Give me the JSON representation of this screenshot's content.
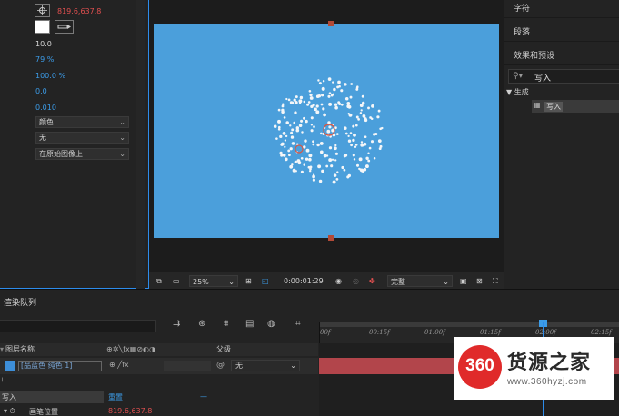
{
  "colors": {
    "accent_blue": "#2d8ceb",
    "comp_background": "#4b9fdb",
    "layer_track": "#b2454b",
    "logo_red": "#e02a2a"
  },
  "effect_controls": {
    "position_value": "819.6,637.8",
    "value_1": "10.0",
    "value_2": "79 %",
    "value_3": "100.0 %",
    "value_4": "0.0",
    "value_5": "0.010",
    "select_1": "颜色",
    "select_2": "无",
    "select_3": "在原始图像上"
  },
  "viewer_toolbar": {
    "zoom": "25%",
    "timecode": "0:00:01:29",
    "quality": "完整"
  },
  "right_panel": {
    "tab_character": "字符",
    "tab_paragraph": "段落",
    "tab_effects_presets": "效果和预设",
    "search_value": "写入",
    "tree_group": "▼ 生成",
    "tree_item": "写入"
  },
  "timeline": {
    "tab_title": "渲染队列",
    "col_layer_name": "图层名称",
    "col_parent": "父级",
    "layer_name": "[品蓝色 纯色 1]",
    "parent_value": "无",
    "effect_row_label": "写入",
    "effect_reset": "重置",
    "effect_reset_dash": "—",
    "prop_label": "画笔位置",
    "prop_value": "819.6,637.8",
    "ticks": [
      "00f",
      "00:15f",
      "01:00f",
      "01:15f",
      "02:00f",
      "02:15f"
    ]
  },
  "watermark": {
    "badge": "360",
    "title": "货源之家",
    "url": "www.360hyzj.com"
  }
}
